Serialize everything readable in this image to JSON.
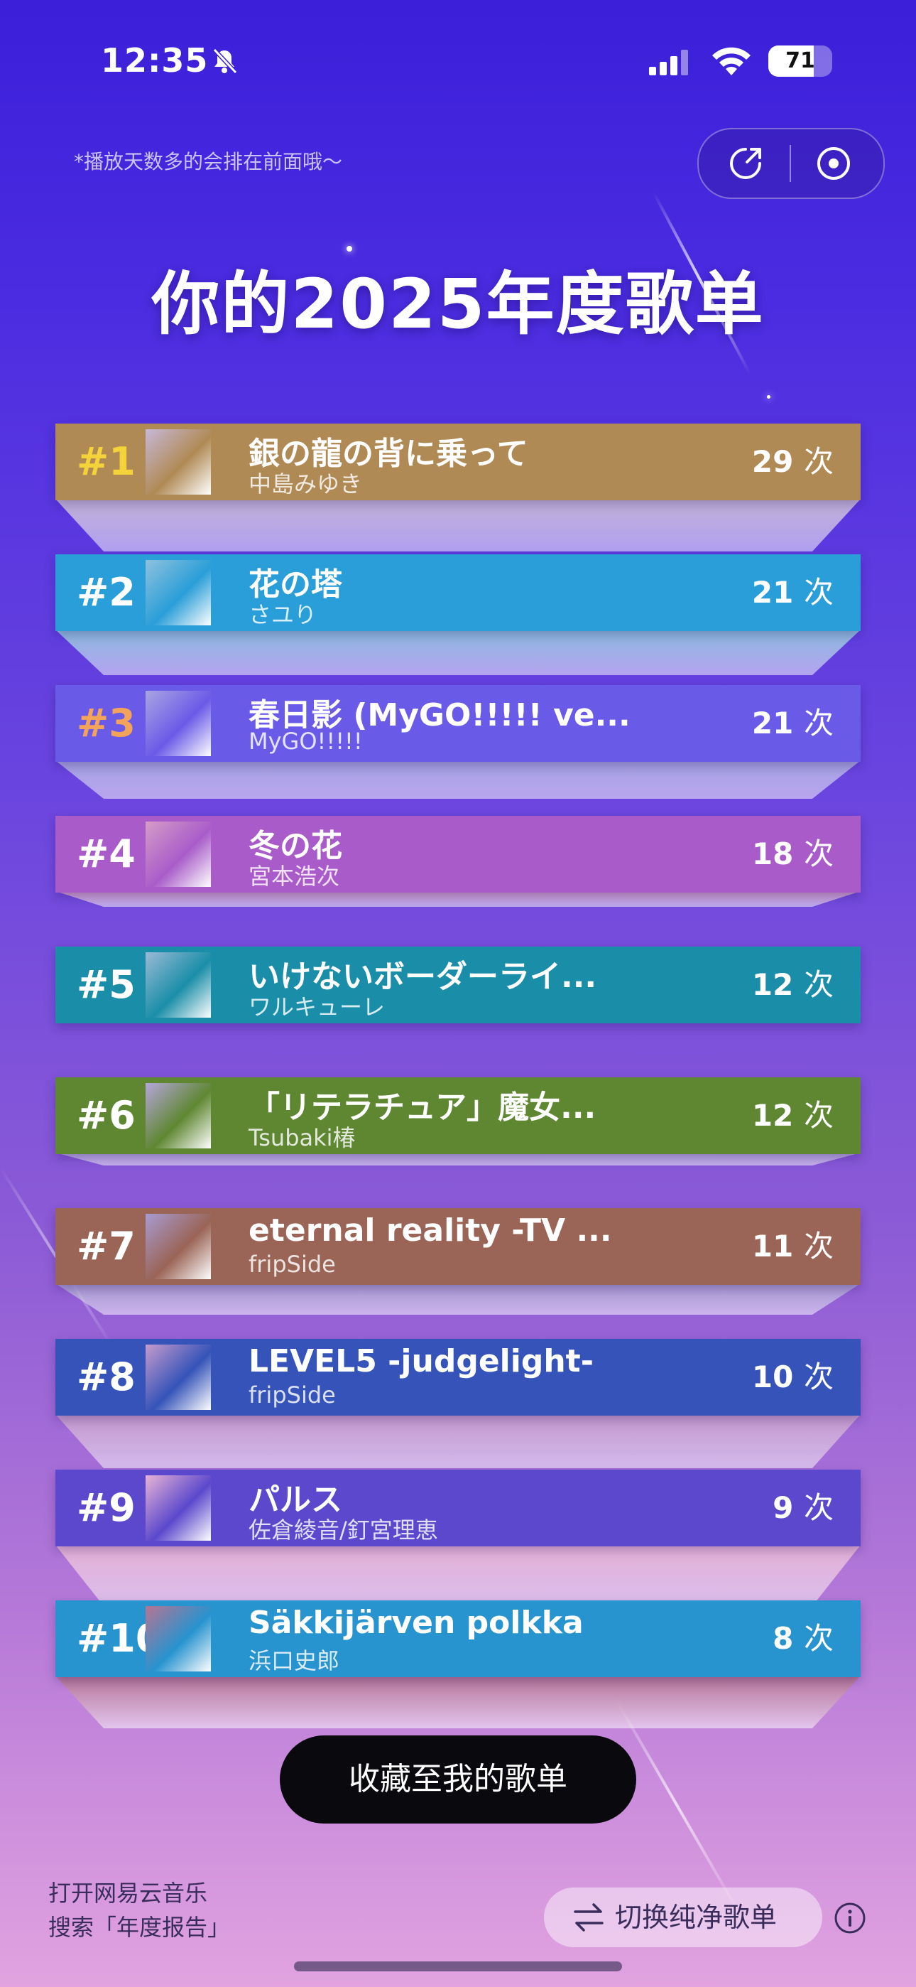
{
  "status_bar": {
    "time": "12:35",
    "battery": "71",
    "battery_level": 0.71
  },
  "hint": "*播放天数多的会排在前面哦～",
  "title": "你的2025年度歌单",
  "top_actions": {
    "share_icon": "share-arrow-icon",
    "target_icon": "target-icon"
  },
  "tracks": [
    {
      "rank": "#1",
      "title": "銀の龍の背に乗って",
      "artist": "中島みゆき",
      "plays": "29",
      "unit": "次",
      "color": "#b08a55",
      "slab": "#c7b8d8",
      "rank_color": "#f3d23a"
    },
    {
      "rank": "#2",
      "title": "花の塔",
      "artist": "さユり",
      "plays": "21",
      "unit": "次",
      "color": "#2a9ed8",
      "slab": "#8ec1de",
      "rank_color": "#ffffff"
    },
    {
      "rank": "#3",
      "title": "春日影 (MyGO!!!!! ve...",
      "artist": "MyGO!!!!!",
      "plays": "21",
      "unit": "次",
      "color": "#6a5ae8",
      "slab": "#a9a5e2",
      "rank_color": "#f4a45a"
    },
    {
      "rank": "#4",
      "title": "冬の花",
      "artist": "宮本浩次",
      "plays": "18",
      "unit": "次",
      "color": "#a95cc9",
      "slab": "#d59cc8",
      "rank_color": "#ffffff"
    },
    {
      "rank": "#5",
      "title": "いけないボーダーライ...",
      "artist": "ワルキューレ",
      "plays": "12",
      "unit": "次",
      "color": "#1a8ea8",
      "slab": "#9bbad6",
      "rank_color": "#ffffff"
    },
    {
      "rank": "#6",
      "title": "「リテラチュア」魔女...",
      "artist": "Tsubaki椿",
      "plays": "12",
      "unit": "次",
      "color": "#5f8732",
      "slab": "#b6a6dc",
      "rank_color": "#ffffff"
    },
    {
      "rank": "#7",
      "title": "eternal reality -TV ...",
      "artist": "fripSide",
      "plays": "11",
      "unit": "次",
      "color": "#9a6456",
      "slab": "#a89bd2",
      "rank_color": "#ffffff"
    },
    {
      "rank": "#8",
      "title": "LEVEL5 -judgelight-",
      "artist": "fripSide",
      "plays": "10",
      "unit": "次",
      "color": "#3553b8",
      "slab": "#c69bcd",
      "rank_color": "#ffffff"
    },
    {
      "rank": "#9",
      "title": "パルス",
      "artist": "佐倉綾音/釘宮理恵",
      "plays": "9",
      "unit": "次",
      "color": "#5b48cc",
      "slab": "#e7b3d6",
      "rank_color": "#ffffff"
    },
    {
      "rank": "#10",
      "title": "Säkkijärven polkka",
      "artist": "浜口史郎",
      "plays": "8",
      "unit": "次",
      "color": "#2793cf",
      "slab": "#b77493",
      "rank_color": "#ffffff"
    }
  ],
  "collect_button": "收藏至我的歌单",
  "footer": {
    "line1": "打开网易云音乐",
    "line2": "搜索「年度报告」",
    "switch_label": "切换纯净歌单"
  }
}
